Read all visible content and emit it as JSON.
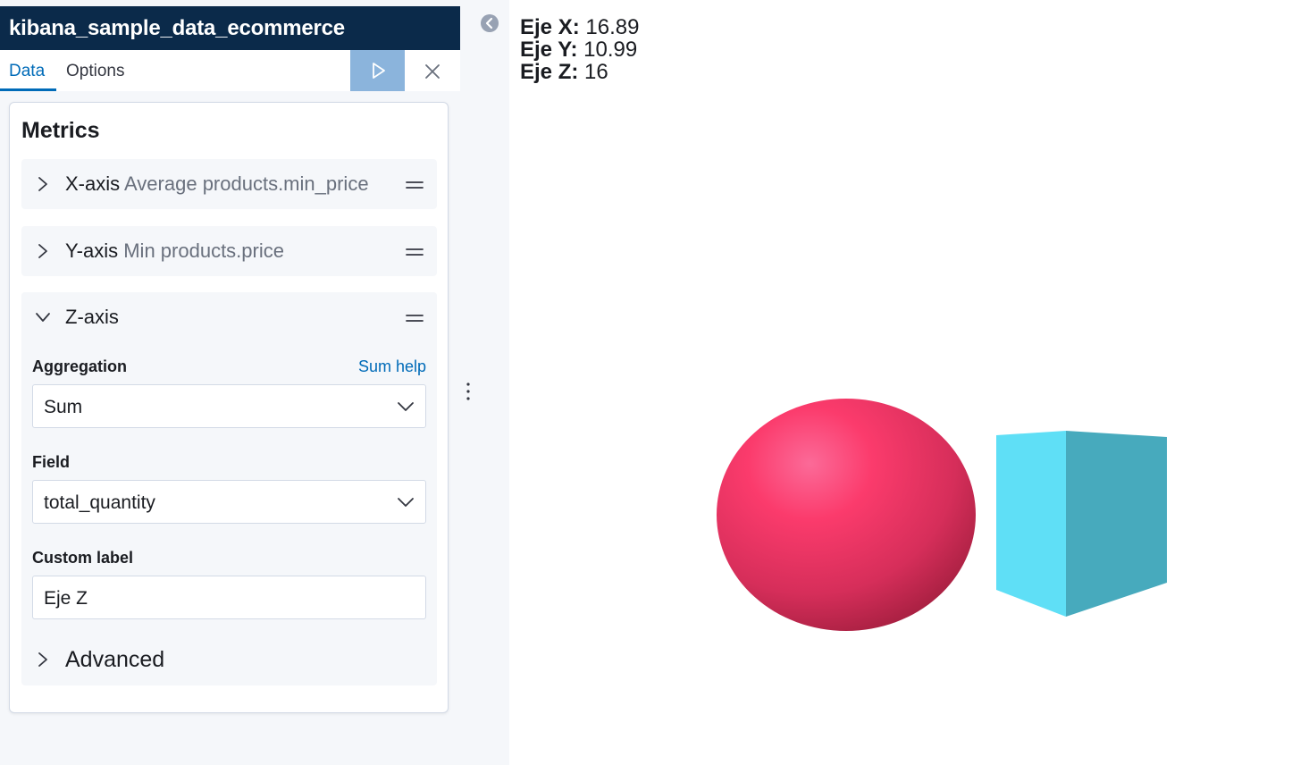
{
  "header": {
    "index_title": "kibana_sample_data_ecommerce"
  },
  "tabs": {
    "data_label": "Data",
    "options_label": "Options"
  },
  "metrics": {
    "title": "Metrics",
    "x_axis": {
      "title": "X-axis",
      "description": "Average products.min_price"
    },
    "y_axis": {
      "title": "Y-axis",
      "description": "Min products.price"
    },
    "z_axis": {
      "title": "Z-axis",
      "aggregation_label": "Aggregation",
      "aggregation_help": "Sum help",
      "aggregation_value": "Sum",
      "field_label": "Field",
      "field_value": "total_quantity",
      "custom_label_label": "Custom label",
      "custom_label_value": "Eje Z",
      "advanced_label": "Advanced"
    }
  },
  "readout": {
    "x_label": "Eje X:",
    "x_value": "16.89",
    "y_label": "Eje Y:",
    "y_value": "10.99",
    "z_label": "Eje Z:",
    "z_value": "16"
  },
  "icons": {
    "apply": "play-icon",
    "discard": "close-icon",
    "collapse": "arrow-left-circle-icon",
    "expand": "chevron-right-icon",
    "collapse_section": "chevron-down-icon",
    "drag": "drag-handle-icon",
    "resize": "vertical-dots-icon"
  },
  "colors": {
    "header_bg": "#0b2a4a",
    "accent": "#006bb8",
    "apply_button": "#8bb4dc",
    "sphere": "#f53f6d",
    "cube_front": "#5fdff6",
    "cube_side": "#47aabd"
  }
}
